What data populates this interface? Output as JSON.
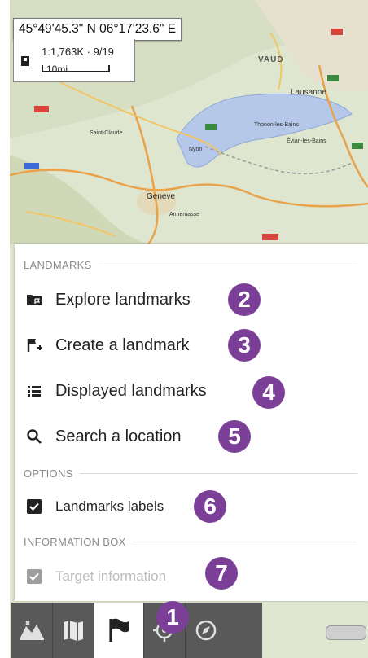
{
  "map": {
    "coordinates": "45°49'45.3\" N 06°17'23.6\" E",
    "scale_text": "1:1,763K · 9/19",
    "scale_unit": "10mi",
    "place_labels": [
      "VAUD",
      "Lausanne",
      "Genève",
      "Saint-Claude",
      "Nyon",
      "Thonon-les-Bains",
      "Annemasse",
      "Évian-les-Bains"
    ]
  },
  "menu": {
    "landmarks_header": "LANDMARKS",
    "items": [
      {
        "label": "Explore landmarks",
        "icon": "folder-flag-icon",
        "badge": "2"
      },
      {
        "label": "Create a landmark",
        "icon": "flag-plus-icon",
        "badge": "3"
      },
      {
        "label": "Displayed landmarks",
        "icon": "list-icon",
        "badge": "4"
      },
      {
        "label": "Search a location",
        "icon": "search-icon",
        "badge": "5"
      }
    ],
    "options_header": "OPTIONS",
    "landmarks_labels": {
      "label": "Landmarks labels",
      "checked": true,
      "badge": "6"
    },
    "info_header": "INFORMATION BOX",
    "target_info": {
      "label": "Target information",
      "checked": true,
      "disabled": true,
      "badge": "7"
    }
  },
  "bottom_bar": {
    "tabs": [
      "layers-icon",
      "map-icon",
      "flag-icon",
      "target-icon",
      "compass-icon"
    ],
    "active_badge": "1"
  },
  "colors": {
    "badge": "#7b3f98",
    "bar": "#595959",
    "lake": "#b6c8ea"
  }
}
